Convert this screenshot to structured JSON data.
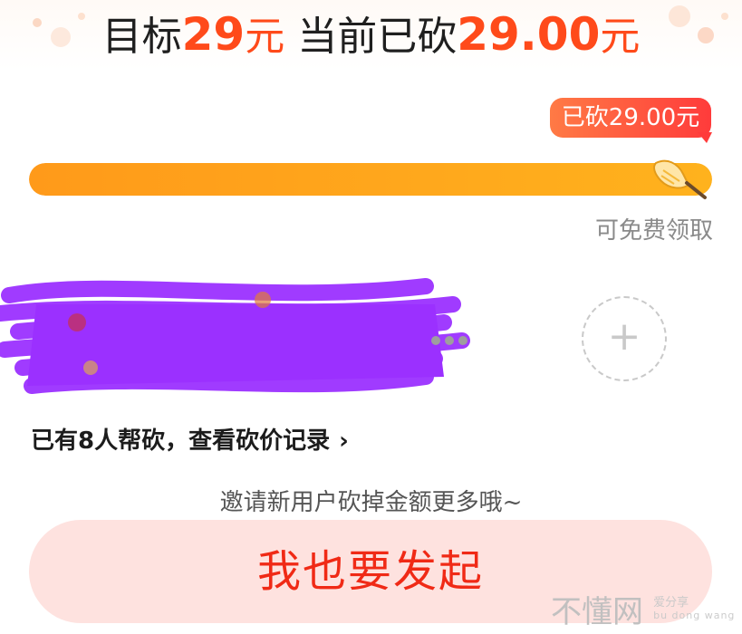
{
  "header": {
    "target_prefix": "目标",
    "target_amount": "29",
    "target_unit": "元",
    "current_prefix": "当前已砍",
    "current_amount": "29.00",
    "current_unit": "元"
  },
  "progress": {
    "badge_text": "已砍29.00元",
    "fraction": 1.0,
    "status_text": "可免费领取",
    "icon": "knife-icon"
  },
  "helpers": {
    "more_icon": "more-dots-icon",
    "add_icon": "plus-icon",
    "add_symbol": "+"
  },
  "helped_link": {
    "text": "已有8人帮砍，查看砍价记录",
    "chevron": "›"
  },
  "invite_tip": "邀请新用户砍掉金额更多哦~",
  "launch_button": "我也要发起",
  "watermark": {
    "main": "不懂网",
    "line1": "爱分享",
    "line2": "bu dong wang"
  },
  "colors": {
    "accent": "#ff4a1a",
    "progress_start": "#ff9a1a",
    "progress_end": "#ffb21d",
    "button_bg": "#fee2df",
    "button_text": "#f02a16",
    "scribble": "#9b30ff"
  }
}
